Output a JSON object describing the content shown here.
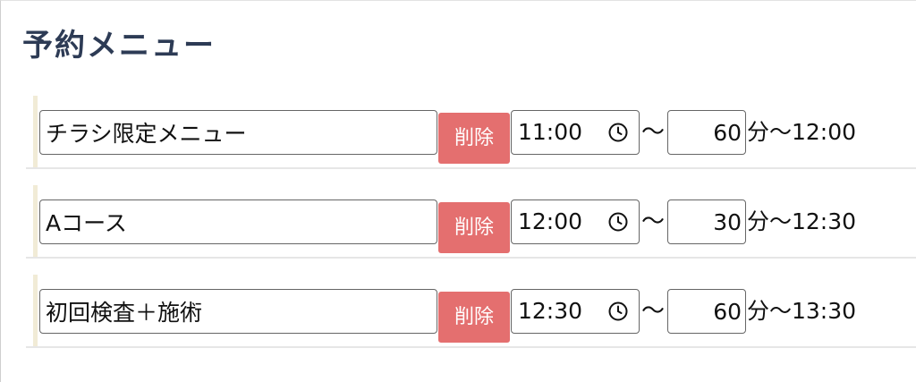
{
  "title": "予約メニュー",
  "tilde": "〜",
  "items": [
    {
      "name": "チラシ限定メニュー",
      "delete_label": "削除",
      "start": "11:00",
      "duration": "60",
      "end_text": "分〜12:00"
    },
    {
      "name": "Aコース",
      "delete_label": "削除",
      "start": "12:00",
      "duration": "30",
      "end_text": "分〜12:30"
    },
    {
      "name": "初回検査＋施術",
      "delete_label": "削除",
      "start": "12:30",
      "duration": "60",
      "end_text": "分〜13:30"
    }
  ],
  "icons": {
    "time": "clock-icon"
  },
  "colors": {
    "delete": "#e46f6f",
    "title": "#2d3b55",
    "accent": "#f1ebd6"
  }
}
